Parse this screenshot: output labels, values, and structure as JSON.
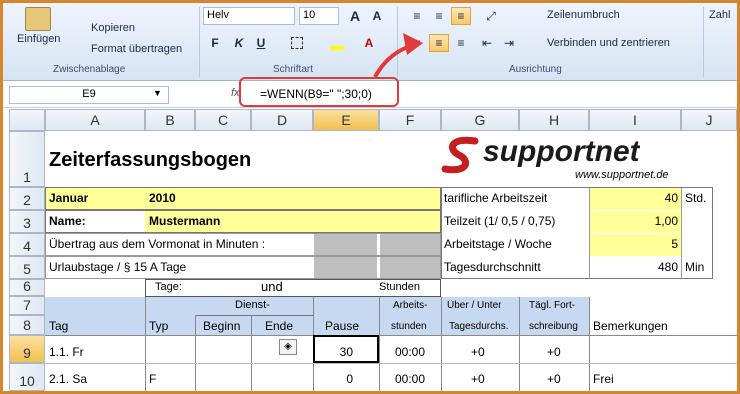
{
  "ribbon": {
    "paste_label": "Einfügen",
    "copy_label": "Kopieren",
    "format_painter_label": "Format übertragen",
    "clipboard_group": "Zwischenablage",
    "font_name": "Helv",
    "font_size": "10",
    "font_group": "Schriftart",
    "bold": "F",
    "italic": "K",
    "underline": "U",
    "wrap_label": "Zeilenumbruch",
    "merge_label": "Verbinden und zentrieren",
    "align_group": "Ausrichtung",
    "number_label": "Zahl",
    "grow_font": "A",
    "shrink_font": "A"
  },
  "formula_bar": {
    "name_box": "E9",
    "fx": "fx",
    "formula": "=WENN(B9=\" \";30;0)"
  },
  "columns": [
    "A",
    "B",
    "C",
    "D",
    "E",
    "F",
    "G",
    "H",
    "I",
    "J"
  ],
  "rows": [
    "1",
    "2",
    "3",
    "4",
    "5",
    "6",
    "7",
    "8",
    "9",
    "10"
  ],
  "sheet": {
    "title": "Zeiterfassungsbogen",
    "logo_main": "supportnet",
    "logo_url": "www.supportnet.de",
    "month_label": "Januar",
    "year": "2010",
    "name_label": "Name:",
    "name_value": "Mustermann",
    "carryover_label": "Übertrag aus dem Vormonat in Minuten :",
    "vacation_label": "Urlaubstage / § 15 A Tage",
    "days_label": "Tage:",
    "and_label": "und",
    "hours_label": "Stunden",
    "tariff_label": "tarifliche Arbeitszeit",
    "tariff_value": "40",
    "tariff_unit": "Std.",
    "parttime_label": "Teilzeit (1/  0,5 / 0,75)",
    "parttime_value": "1,00",
    "workdays_label": "Arbeitstage / Woche",
    "workdays_value": "5",
    "daily_avg_label": "Tagesdurchschnitt",
    "daily_avg_value": "480",
    "daily_avg_unit": "Min"
  },
  "table_headers": {
    "tag": "Tag",
    "typ": "Typ",
    "dienst": "Dienst-",
    "beginn": "Beginn",
    "ende": "Ende",
    "pause": "Pause",
    "arbeits": "Arbeits-",
    "stunden": "stunden",
    "ueber": "Über / Unter",
    "tagesdurchs": "Tagesdurchs.",
    "taegl": "Tägl. Fort-",
    "schreibung": "schreibung",
    "bemerkungen": "Bemerkungen"
  },
  "table_rows": [
    {
      "tag": "1.1. Fr",
      "typ": "",
      "pause": "30",
      "stunden": "00:00",
      "ueber": "+0",
      "fort": "+0",
      "bem": ""
    },
    {
      "tag": "2.1. Sa",
      "typ": "F",
      "pause": "0",
      "stunden": "00:00",
      "ueber": "+0",
      "fort": "+0",
      "bem": "Frei"
    }
  ]
}
